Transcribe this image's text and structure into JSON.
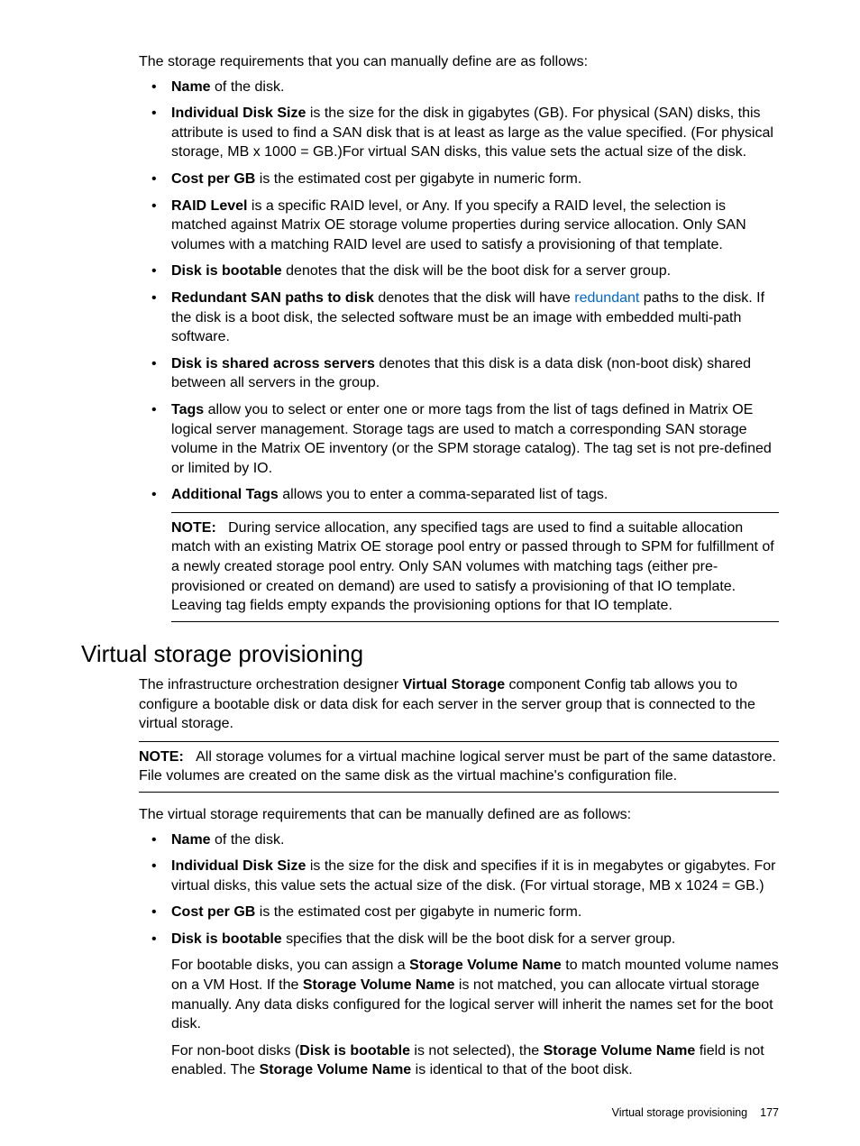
{
  "intro1": "The storage requirements that you can manually define are as follows:",
  "list1": {
    "i0": {
      "term": "Name",
      "rest": " of the disk."
    },
    "i1": {
      "term": "Individual Disk Size",
      "rest": " is the size for the disk in gigabytes (GB). For physical (SAN) disks, this attribute is used to find a SAN disk that is at least as large as the value specified. (For physical storage, MB x 1000 = GB.)For virtual SAN disks, this value sets the actual size of the disk."
    },
    "i2": {
      "term": "Cost per GB",
      "rest": " is the estimated cost per gigabyte in numeric form."
    },
    "i3": {
      "term": "RAID Level",
      "rest": " is a specific RAID level, or Any. If you specify a RAID level, the selection is matched against Matrix OE storage volume properties during service allocation. Only SAN volumes with a matching RAID level are used to satisfy a provisioning of that template."
    },
    "i4": {
      "term": "Disk is bootable",
      "rest": " denotes that the disk will be the boot disk for a server group."
    },
    "i5": {
      "term": "Redundant SAN paths to disk",
      "pre": " denotes that the disk will have ",
      "link": "redundant",
      "post": " paths to the disk. If the disk is a boot disk, the selected software must be an image with embedded multi-path software."
    },
    "i6": {
      "term": "Disk is shared across servers",
      "rest": " denotes that this disk is a data disk (non-boot disk) shared between all servers in the group."
    },
    "i7": {
      "term": "Tags",
      "rest": " allow you to select or enter one or more tags from the list of tags defined in Matrix OE logical server management. Storage tags are used to match a corresponding SAN storage volume in the Matrix OE inventory (or the SPM storage catalog). The tag set is not pre-defined or limited by IO."
    },
    "i8": {
      "term": "Additional Tags",
      "rest": " allows you to enter a comma-separated list of tags.",
      "note_label": "NOTE:",
      "note_body": "During service allocation, any specified tags are used to find a suitable allocation match with an existing Matrix OE storage pool entry or passed through to SPM for fulfillment of a newly created storage pool entry. Only SAN volumes with matching tags (either pre-provisioned or created on demand) are used to satisfy a provisioning of that IO template. Leaving tag fields empty expands the provisioning options for that IO template."
    }
  },
  "heading": "Virtual storage provisioning",
  "vsp_intro_pre": "The infrastructure orchestration designer ",
  "vsp_intro_bold": "Virtual Storage",
  "vsp_intro_post": " component Config tab allows you to configure a bootable disk or data disk for each server in the server group that is connected to the virtual storage.",
  "note2_label": "NOTE:",
  "note2_body": "All storage volumes for a virtual machine logical server must be part of the same datastore. File volumes are created on the same disk as the virtual machine's configuration file.",
  "intro2": "The virtual storage requirements that can be manually defined are as follows:",
  "list2": {
    "i0": {
      "term": "Name",
      "rest": " of the disk."
    },
    "i1": {
      "term": "Individual Disk Size",
      "rest": " is the size for the disk and specifies if it is in megabytes or gigabytes. For virtual disks, this value sets the actual size of the disk. (For virtual storage, MB x 1024 = GB.)"
    },
    "i2": {
      "term": "Cost per GB",
      "rest": " is the estimated cost per gigabyte in numeric form."
    },
    "i3": {
      "term": "Disk is bootable",
      "rest": " specifies that the disk will be the boot disk for a server group.",
      "p2_pre": "For bootable disks, you can assign a ",
      "p2_b1": "Storage Volume Name",
      "p2_mid": " to match mounted volume names on a VM Host. If the ",
      "p2_b2": "Storage Volume Name",
      "p2_post": " is not matched, you can allocate virtual storage manually. Any data disks configured for the logical server will inherit the names set for the boot disk.",
      "p3_pre": "For non-boot disks (",
      "p3_b1": "Disk is bootable",
      "p3_mid1": " is not selected), the ",
      "p3_b2": "Storage Volume Name",
      "p3_mid2": " field is not enabled. The ",
      "p3_b3": "Storage Volume Name",
      "p3_post": " is identical to that of the boot disk."
    }
  },
  "footer_text": "Virtual storage provisioning",
  "page_num": "177"
}
